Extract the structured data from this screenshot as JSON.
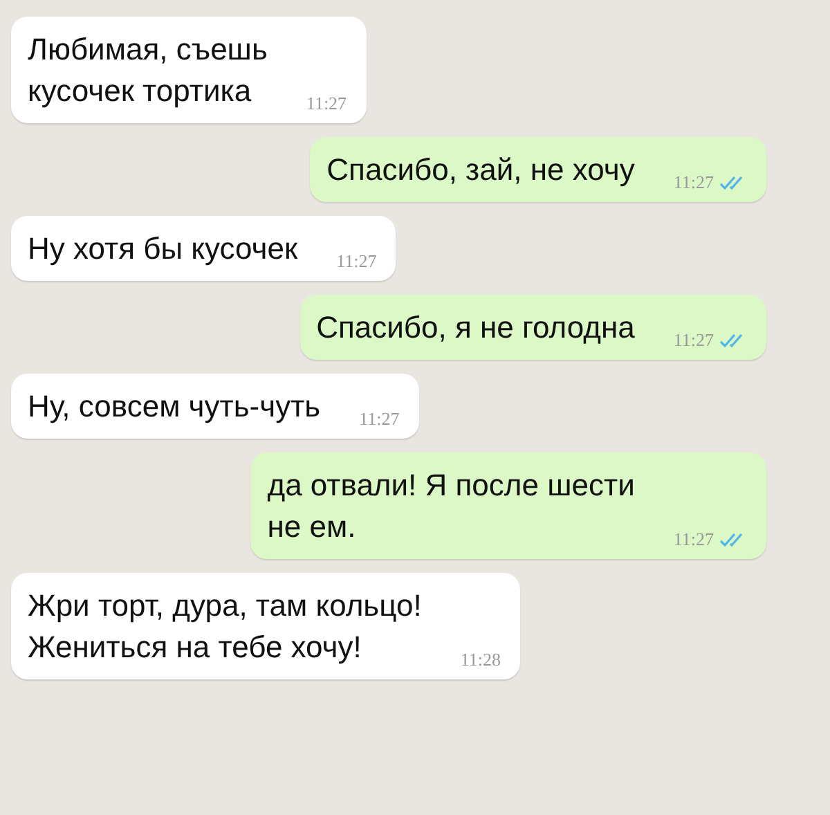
{
  "messages": [
    {
      "text": "Любимая, съешь\nкусочек тортика",
      "time": "11:27",
      "outgoing": false
    },
    {
      "text": "Спасибо, зай, не хочу",
      "time": "11:27",
      "outgoing": true,
      "read": true
    },
    {
      "text": "Ну хотя бы кусочек",
      "time": "11:27",
      "outgoing": false
    },
    {
      "text": "Спасибо, я не голодна",
      "time": "11:27",
      "outgoing": true,
      "read": true
    },
    {
      "text": "Ну, совсем чуть-чуть",
      "time": "11:27",
      "outgoing": false
    },
    {
      "text": "да отвали! Я после шести\nне ем.",
      "time": "11:27",
      "outgoing": true,
      "read": true
    },
    {
      "text": "Жри торт, дура, там кольцо!\nЖениться на тебе хочу!",
      "time": "11:28",
      "outgoing": false
    }
  ]
}
